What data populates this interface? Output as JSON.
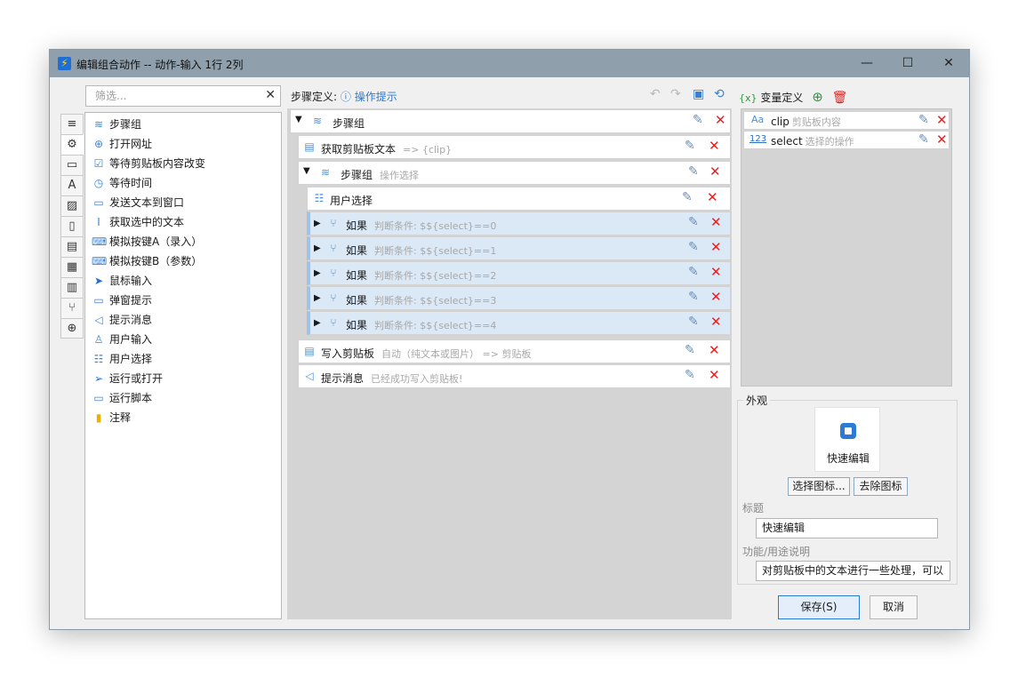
{
  "window": {
    "title": "编辑组合动作 -- 动作-输入 1行 2列",
    "min": "—",
    "max": "☐",
    "close": "✕"
  },
  "filter": {
    "placeholder": "筛选...",
    "clear": "✕"
  },
  "side_tabs": [
    "list-icon",
    "gear-icon",
    "window-icon",
    "text-icon",
    "image-icon",
    "clipboard-icon",
    "document-icon",
    "windows-icon",
    "grid-icon",
    "branch-icon",
    "globe-icon"
  ],
  "actions": [
    {
      "label": "步骤组",
      "icon": "layers-icon"
    },
    {
      "label": "打开网址",
      "icon": "globe-icon"
    },
    {
      "label": "等待剪贴板内容改变",
      "icon": "clipboard-check-icon"
    },
    {
      "label": "等待时间",
      "icon": "clock-icon"
    },
    {
      "label": "发送文本到窗口",
      "icon": "chat-icon"
    },
    {
      "label": "获取选中的文本",
      "icon": "text-cursor-icon"
    },
    {
      "label": "模拟按键A（录入）",
      "icon": "keyboard-icon"
    },
    {
      "label": "模拟按键B（参数）",
      "icon": "keyboard-icon"
    },
    {
      "label": "鼠标输入",
      "icon": "cursor-icon"
    },
    {
      "label": "弹窗提示",
      "icon": "popup-icon"
    },
    {
      "label": "提示消息",
      "icon": "megaphone-icon"
    },
    {
      "label": "用户输入",
      "icon": "user-input-icon"
    },
    {
      "label": "用户选择",
      "icon": "list-select-icon"
    },
    {
      "label": "运行或打开",
      "icon": "send-icon"
    },
    {
      "label": "运行脚本",
      "icon": "script-icon"
    },
    {
      "label": "注释",
      "icon": "note-icon"
    }
  ],
  "steps_header": {
    "label": "步骤定义:",
    "hint_icon": "ⓘ",
    "hint": "操作提示"
  },
  "steps": [
    {
      "label": "步骤组",
      "sub": ""
    },
    {
      "label": "获取剪贴板文本",
      "sub": "=> {clip}"
    },
    {
      "label": "步骤组",
      "sub": "操作选择"
    },
    {
      "label": "用户选择",
      "sub": ""
    },
    {
      "label": "如果",
      "sub": "判断条件: $${select}==0"
    },
    {
      "label": "如果",
      "sub": "判断条件: $${select}==1"
    },
    {
      "label": "如果",
      "sub": "判断条件: $${select}==2"
    },
    {
      "label": "如果",
      "sub": "判断条件: $${select}==3"
    },
    {
      "label": "如果",
      "sub": "判断条件: $${select}==4"
    },
    {
      "label": "写入剪贴板",
      "sub": "自动（纯文本或图片） => 剪贴板"
    },
    {
      "label": "提示消息",
      "sub": "已经成功写入剪贴板!"
    }
  ],
  "vars_header": {
    "icon": "{x}",
    "label": "变量定义"
  },
  "variables": [
    {
      "name": "clip",
      "desc": "剪贴板内容",
      "icon": "text-type-icon"
    },
    {
      "name": "select",
      "desc": "选择的操作",
      "icon": "number-type-icon"
    }
  ],
  "appearance": {
    "group": "外观",
    "icon_label": "快速编辑",
    "choose_icon": "选择图标...",
    "remove_icon": "去除图标",
    "title_label": "标题",
    "title_value": "快速编辑",
    "desc_label": "功能/用途说明",
    "desc_value": "对剪贴板中的文本进行一些处理，可以"
  },
  "footer": {
    "save": "保存(S)",
    "cancel": "取消"
  },
  "colors": {
    "accent": "#2a7ad6",
    "delete": "#e52222",
    "titlebar": "#8fa0ac"
  }
}
